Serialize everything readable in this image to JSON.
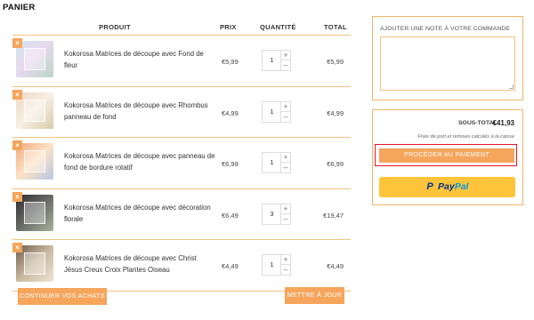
{
  "page": {
    "title": "PANIER"
  },
  "cart": {
    "headers": {
      "product": "PRODUIT",
      "price": "PRIX",
      "quantity": "QUANTITÉ",
      "total": "TOTAL"
    },
    "remove_glyph": "×",
    "qty_up_glyph": "+",
    "qty_down_glyph": "–",
    "items": [
      {
        "name": "Kokorosa Matrices de découpe avec Fond de fleur",
        "price": "€5,99",
        "quantity": "1",
        "total": "€5,99"
      },
      {
        "name": "Kokorosa Matrices de découpe avec Rhombus panneau de fond",
        "price": "€4,99",
        "quantity": "1",
        "total": "€4,99"
      },
      {
        "name": "Kokorosa Matrices de découpe avec panneau de fond de bordure rotatif",
        "price": "€6,99",
        "quantity": "1",
        "total": "€6,99"
      },
      {
        "name": "Kokorosa Matrices de découpe avec décoration florale",
        "price": "€6,49",
        "quantity": "3",
        "total": "€19,47"
      },
      {
        "name": "Kokorosa Matrices de découpe avec Christ Jésus Creux Croix Plantes Oiseau",
        "price": "€4,49",
        "quantity": "1",
        "total": "€4,49"
      }
    ],
    "continue_label": "CONTINUER VOS ACHATS",
    "update_label": "METTRE À JOUR"
  },
  "note": {
    "label": "AJOUTER UNE NOTE À VOTRE COMMANDE"
  },
  "summary": {
    "subtotal_label": "SOUS-TOTAL",
    "subtotal_value": "€41,93",
    "shipping_note": "Frais de port et remises calculés à la caisse",
    "checkout_label": "PROCÉDER AU PAIEMENT",
    "paypal": {
      "mark": "P",
      "pay": "Pay",
      "pal": "Pal"
    }
  },
  "colors": {
    "accent": "#f5a55c",
    "border": "#f0c37e",
    "highlight": "#e0192c",
    "paypal_bg": "#ffc439",
    "paypal_blue": "#003087",
    "paypal_light": "#009cde"
  }
}
